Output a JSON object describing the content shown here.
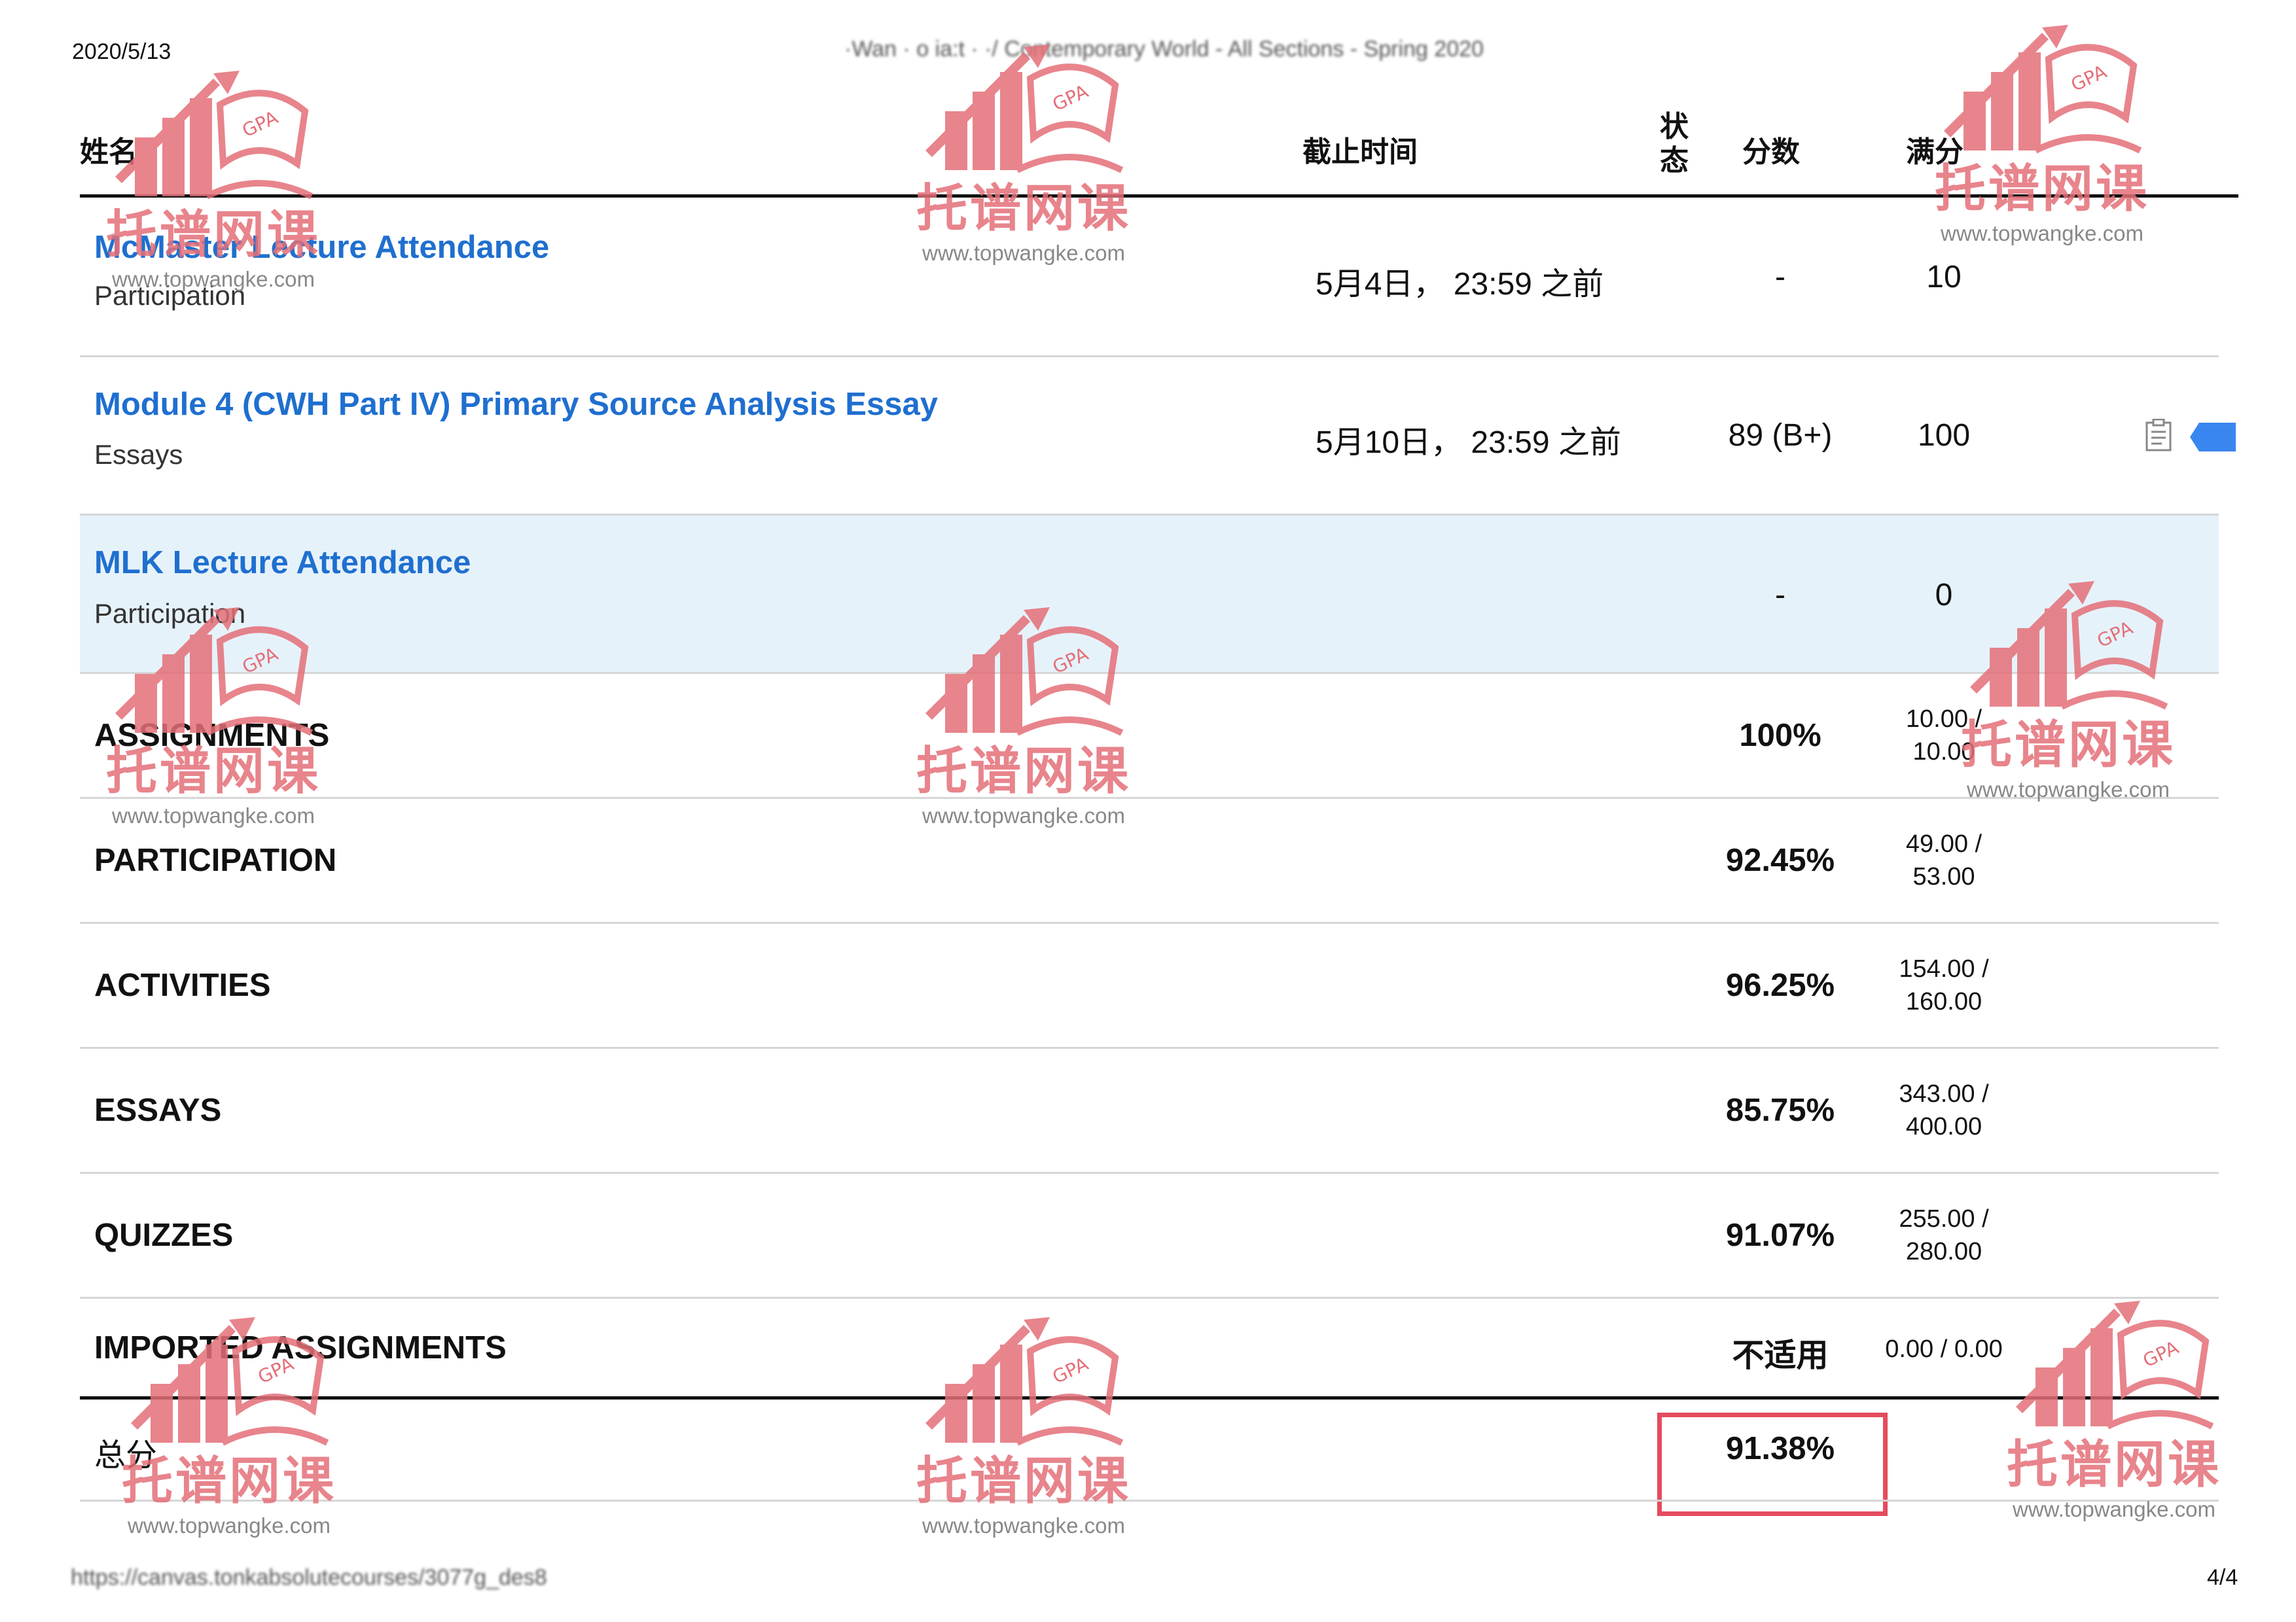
{
  "print": {
    "date": "2020/5/13",
    "title": "·Wan ·  o ia:t   ·  ·/ Contemporary World - All Sections - Spring 2020",
    "url": "https://canvas.tonkabsolutecourses/3077g_des8",
    "page": "4/4"
  },
  "headers": {
    "name": "姓名",
    "due": "截止时间",
    "status": "状态",
    "score": "分数",
    "total": "满分"
  },
  "assignments": [
    {
      "title": "McMaster Lecture Attendance",
      "category": "Participation",
      "due": "5月4日， 23:59 之前",
      "score": "-",
      "total": "10",
      "highlighted": false
    },
    {
      "title": "Module 4 (CWH Part IV) Primary Source Analysis Essay",
      "category": "Essays",
      "due": "5月10日， 23:59 之前",
      "score": "89 (B+)",
      "total": "100",
      "highlighted": false
    },
    {
      "title": "MLK Lecture Attendance",
      "category": "Participation",
      "due": "",
      "score": "-",
      "total": "0",
      "highlighted": true
    }
  ],
  "groups": [
    {
      "name": "ASSIGNMENTS",
      "percent": "100%",
      "frac_top": "10.00 /",
      "frac_bottom": "10.00"
    },
    {
      "name": "PARTICIPATION",
      "percent": "92.45%",
      "frac_top": "49.00 /",
      "frac_bottom": "53.00"
    },
    {
      "name": "ACTIVITIES",
      "percent": "96.25%",
      "frac_top": "154.00 /",
      "frac_bottom": "160.00"
    },
    {
      "name": "ESSAYS",
      "percent": "85.75%",
      "frac_top": "343.00 /",
      "frac_bottom": "400.00"
    },
    {
      "name": "QUIZZES",
      "percent": "91.07%",
      "frac_top": "255.00 /",
      "frac_bottom": "280.00"
    },
    {
      "name": "IMPORTED ASSIGNMENTS",
      "percent": "不适用",
      "frac_top": "0.00 / 0.00",
      "frac_bottom": ""
    }
  ],
  "total": {
    "label": "总分",
    "percent": "91.38%"
  },
  "watermark": {
    "logo_text": "GPA",
    "brand": "托谱网课",
    "url": "www.topwangke.com"
  },
  "colors": {
    "link": "#1f6fcf",
    "highlight_row": "#e6f2fa",
    "total_box": "#e44b5e",
    "watermark": "#e46f78",
    "flag": "#3a86f0"
  },
  "icons": {
    "row_clipboard": "clipboard-icon",
    "row_flag": "flag-icon"
  }
}
